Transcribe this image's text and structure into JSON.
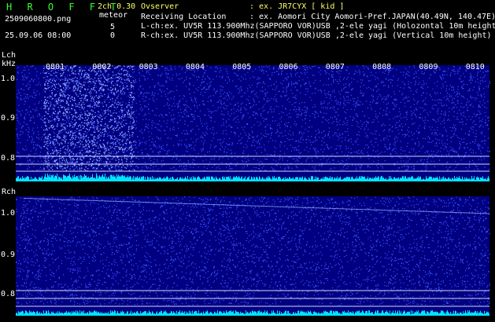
{
  "header": {
    "app_title": "H R O F F T",
    "filename": "2509060800.png",
    "datetime": "25.09.06 08:00",
    "mode": "2ch 0.30",
    "meteor_label": "meteor",
    "meteor_count_l": "5",
    "meteor_count_r": "0"
  },
  "info": {
    "observer_label": "Ovserver",
    "observer_value": ": ex. JR7CYX [ kid ]",
    "location_label": "Receiving Location",
    "location_value": ": ex. Aomori City Aomori-Pref.JAPAN(40.49N, 140.47E)",
    "lch_line": "L-ch:ex. UV5R 113.900Mhz(SAPPORO VOR)USB ,2-ele yagi (Holozontal 10m height)",
    "rch_line": "R-ch:ex. UV5R 113.900Mhz(SAPPORO VOR)USB ,2-ele yagi (Vertical 10m height)"
  },
  "lch": {
    "label": "Lch",
    "unit": "kHz",
    "yticks": [
      "1.0",
      "0.9",
      "0.8"
    ]
  },
  "rch": {
    "label": "Rch",
    "yticks": [
      "1.0",
      "0.9",
      "0.8"
    ]
  },
  "time_ticks": [
    "0801",
    "0802",
    "0803",
    "0804",
    "0805",
    "0806",
    "0807",
    "0808",
    "0809",
    "0810"
  ],
  "colors": {
    "background": "#000000",
    "spectrogram": "#000080",
    "noise": "#3c50ff",
    "signal": "#00e5ff",
    "title_green": "#33ff33",
    "mode_yellow": "#ffff66"
  }
}
